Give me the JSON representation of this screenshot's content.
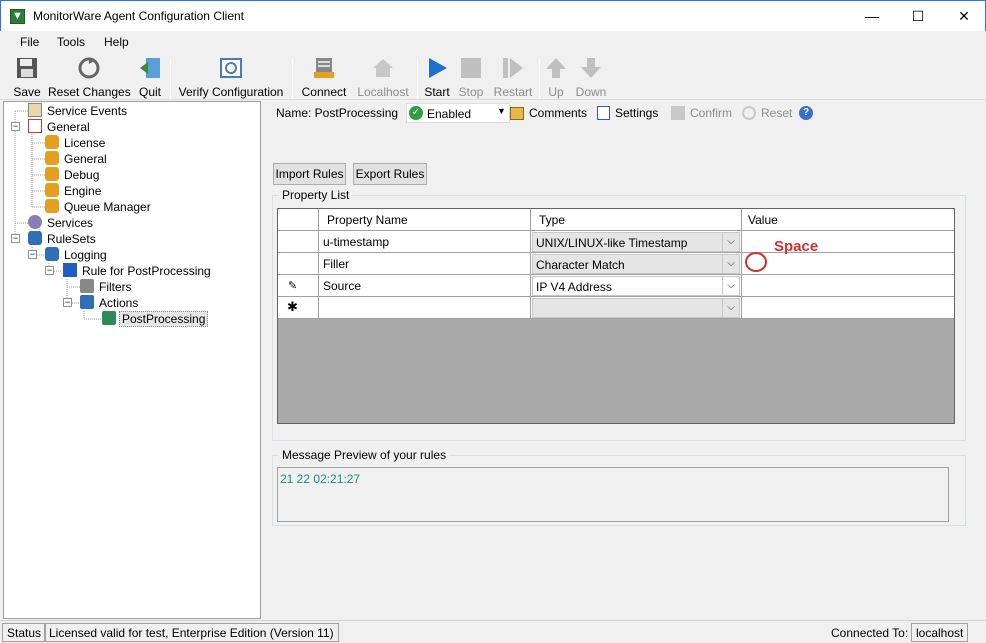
{
  "window": {
    "title": "MonitorWare Agent Configuration Client"
  },
  "menu": [
    "File",
    "Tools",
    "Help"
  ],
  "toolbar": {
    "save": "Save",
    "reset": "Reset Changes",
    "quit": "Quit",
    "verify": "Verify Configuration",
    "connect": "Connect",
    "localhost": "Localhost",
    "start": "Start",
    "stop": "Stop",
    "restart": "Restart",
    "up": "Up",
    "down": "Down"
  },
  "tree": {
    "service_events": "Service Events",
    "general": "General",
    "license": "License",
    "general_sub": "General",
    "debug": "Debug",
    "engine": "Engine",
    "queue_manager": "Queue Manager",
    "services": "Services",
    "rulesets": "RuleSets",
    "logging": "Logging",
    "rule": "Rule for PostProcessing",
    "filters": "Filters",
    "actions": "Actions",
    "postprocessing": "PostProcessing"
  },
  "props": {
    "name": "Name: PostProcessing",
    "enabled": "Enabled",
    "comments": "Comments",
    "settings": "Settings",
    "confirm": "Confirm",
    "reset": "Reset"
  },
  "buttons": {
    "import": "Import Rules",
    "export": "Export Rules"
  },
  "property_list": {
    "label": "Property List",
    "headers": {
      "name": "Property Name",
      "type": "Type",
      "value": "Value"
    },
    "rows": [
      {
        "name": "u-timestamp",
        "type": "UNIX/LINUX-like Timestamp",
        "value": ""
      },
      {
        "name": "Filler",
        "type": "Character Match",
        "value": ""
      },
      {
        "name": "Source",
        "type": "IP V4 Address",
        "value": ""
      }
    ],
    "annotation": "Space",
    "annotation_color": "#d32f2f"
  },
  "preview": {
    "label": "Message Preview of your rules",
    "text": "21 22 02:21:27",
    "text_color": "#1a8a8a"
  },
  "status": {
    "label": "Status",
    "license": "Licensed valid for test, Enterprise Edition (Version 11)",
    "connected_label": "Connected To:",
    "host": "localhost"
  }
}
